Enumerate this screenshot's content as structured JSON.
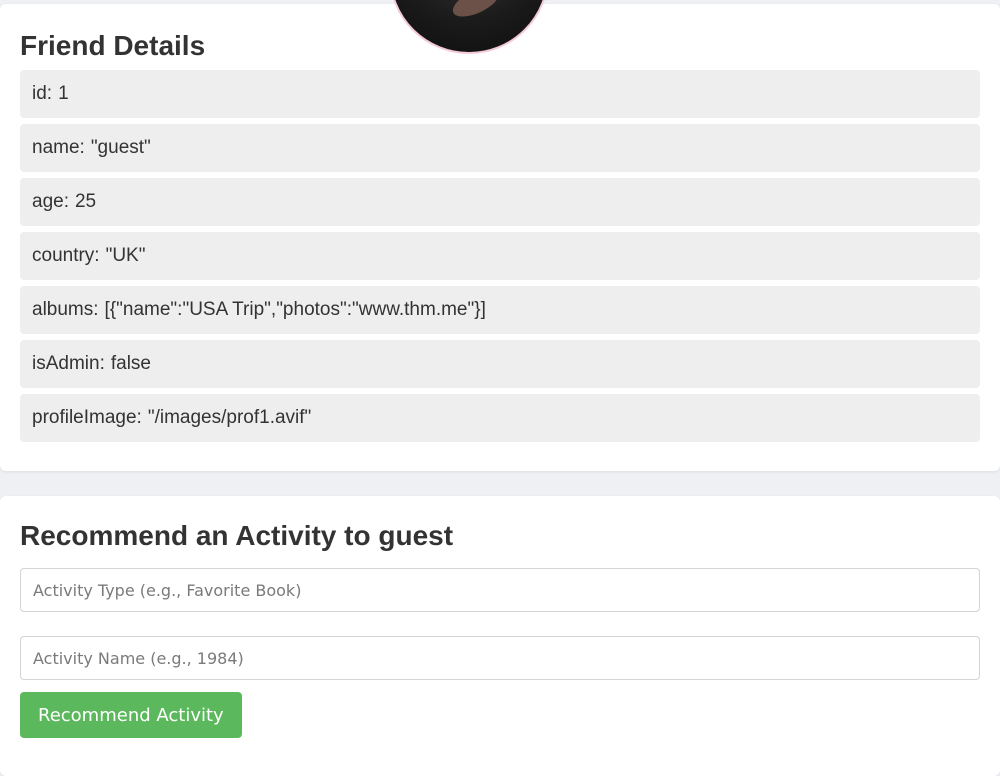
{
  "friend_details": {
    "title": "Friend Details",
    "rows": [
      {
        "key": "id:",
        "value": "1"
      },
      {
        "key": "name:",
        "value": "\"guest\""
      },
      {
        "key": "age:",
        "value": "25"
      },
      {
        "key": "country:",
        "value": "\"UK\""
      },
      {
        "key": "albums:",
        "value": "[{\"name\":\"USA Trip\",\"photos\":\"www.thm.me\"}]"
      },
      {
        "key": "isAdmin:",
        "value": "false"
      },
      {
        "key": "profileImage:",
        "value": "\"/images/prof1.avif\""
      }
    ]
  },
  "recommend": {
    "title": "Recommend an Activity to guest",
    "activity_type_placeholder": "Activity Type (e.g., Favorite Book)",
    "activity_name_placeholder": "Activity Name (e.g., 1984)",
    "button_label": "Recommend Activity"
  },
  "colors": {
    "button": "#5cb85c",
    "row_background": "#eeeeee",
    "avatar_border": "#f4c9d6"
  }
}
